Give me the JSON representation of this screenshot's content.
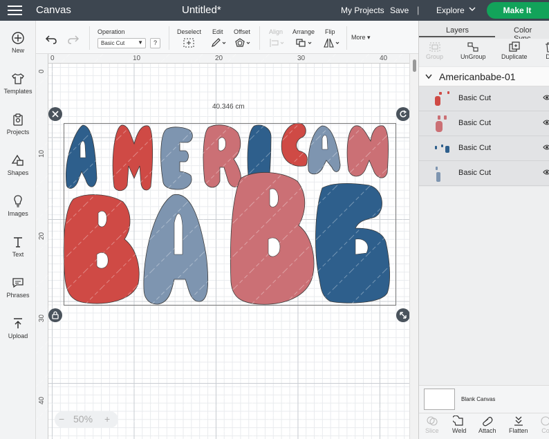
{
  "topbar": {
    "app_title": "Canvas",
    "doc_title": "Untitled*",
    "my_projects": "My Projects",
    "save": "Save",
    "separator": "|",
    "explore": "Explore",
    "make_it": "Make It"
  },
  "leftbar": {
    "items": [
      {
        "label": "New",
        "icon": "plus-circle-icon"
      },
      {
        "label": "Templates",
        "icon": "shirt-icon"
      },
      {
        "label": "Projects",
        "icon": "projects-icon"
      },
      {
        "label": "Shapes",
        "icon": "shapes-icon"
      },
      {
        "label": "Images",
        "icon": "bulb-icon"
      },
      {
        "label": "Text",
        "icon": "text-icon"
      },
      {
        "label": "Phrases",
        "icon": "chat-icon"
      },
      {
        "label": "Upload",
        "icon": "upload-icon"
      }
    ]
  },
  "toolbar": {
    "operation_label": "Operation",
    "operation_value": "Basic Cut",
    "help": "?",
    "deselect": "Deselect",
    "edit": "Edit",
    "offset": "Offset",
    "align": "Align",
    "arrange": "Arrange",
    "flip": "Flip",
    "more": "More"
  },
  "canvas": {
    "ruler_h": [
      "0",
      "10",
      "20",
      "30",
      "40"
    ],
    "ruler_v": [
      "0",
      "10",
      "20",
      "30",
      "40"
    ],
    "width_readout": "40.346 cm",
    "zoom": "50%",
    "zoom_minus": "−",
    "zoom_plus": "+",
    "artwork_text": [
      "AMERICAN",
      "BABE"
    ],
    "colors": {
      "navy": "#2e5f8c",
      "red": "#cf4a45",
      "slate": "#7e95b0",
      "pink": "#cb7075"
    }
  },
  "rightpanel": {
    "tabs": [
      "Layers",
      "Color Sync"
    ],
    "actions": [
      {
        "label": "Group",
        "disabled": true
      },
      {
        "label": "UnGroup",
        "disabled": false
      },
      {
        "label": "Duplicate",
        "disabled": false
      },
      {
        "label": "De",
        "disabled": false
      }
    ],
    "group_name": "Americanbabe-01",
    "layers": [
      {
        "name": "Basic Cut",
        "color": "#cf4a45"
      },
      {
        "name": "Basic Cut",
        "color": "#cb7075"
      },
      {
        "name": "Basic Cut",
        "color": "#2e5f8c"
      },
      {
        "name": "Basic Cut",
        "color": "#7e95b0"
      }
    ],
    "blank_canvas": "Blank Canvas",
    "bottom_actions": [
      {
        "label": "Slice",
        "disabled": true
      },
      {
        "label": "Weld",
        "disabled": false
      },
      {
        "label": "Attach",
        "disabled": false
      },
      {
        "label": "Flatten",
        "disabled": false
      },
      {
        "label": "Co",
        "disabled": true
      }
    ]
  }
}
